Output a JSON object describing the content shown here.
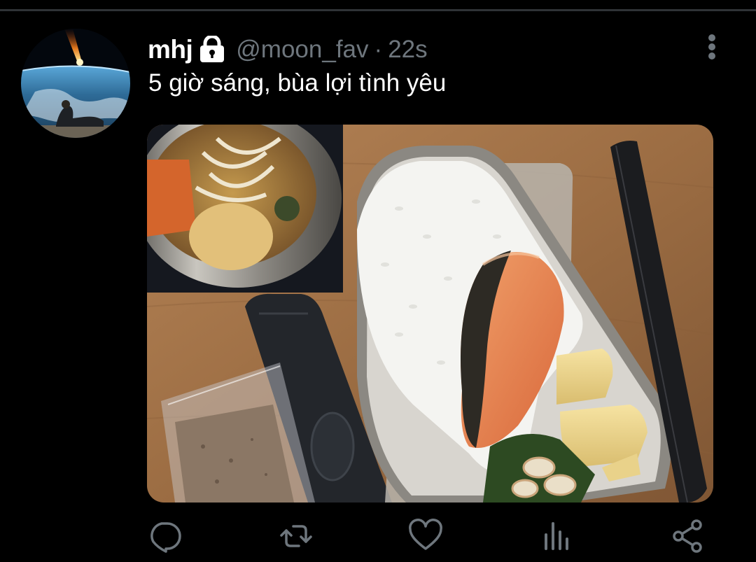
{
  "tweet": {
    "display_name": "mhj",
    "handle": "@moon_fav",
    "separator": "·",
    "timestamp": "22s",
    "text": "5 giờ sáng, bùa lợi tình yêu",
    "protected": true
  },
  "icons": {
    "lock": "lock-icon",
    "more": "more-vertical-icon",
    "reply": "reply-icon",
    "retweet": "retweet-icon",
    "like": "heart-icon",
    "analytics": "analytics-icon",
    "share": "share-icon"
  },
  "colors": {
    "background": "#000000",
    "text": "#ffffff",
    "secondary": "#6e767d",
    "divider": "#2f3336"
  }
}
